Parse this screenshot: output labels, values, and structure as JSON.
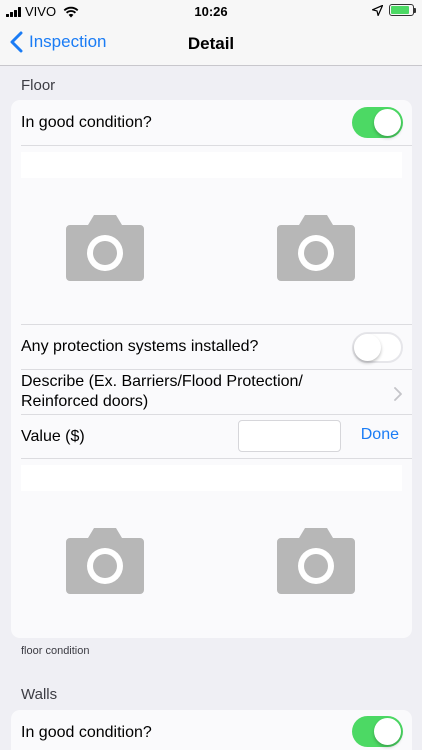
{
  "status_bar": {
    "carrier": "VIVO",
    "time": "10:26",
    "battery_level": 0.85,
    "battery_color": "#4cd964"
  },
  "nav": {
    "back_label": "Inspection",
    "title": "Detail",
    "accent_color": "#1a7cf5"
  },
  "floor": {
    "header": "Floor",
    "condition_label": "In good condition?",
    "condition_on": true,
    "protection_label": "Any protection systems installed?",
    "protection_on": false,
    "describe_label_line1": "Describe (Ex. Barriers/Flood Protection/",
    "describe_label_line2": "Reinforced doors)",
    "value_label": "Value ($)",
    "value_input": "",
    "done_label": "Done",
    "footer": "floor condition",
    "photo_icon": "camera-icon"
  },
  "walls": {
    "header": "Walls",
    "condition_label": "In good condition?",
    "condition_on": true
  }
}
